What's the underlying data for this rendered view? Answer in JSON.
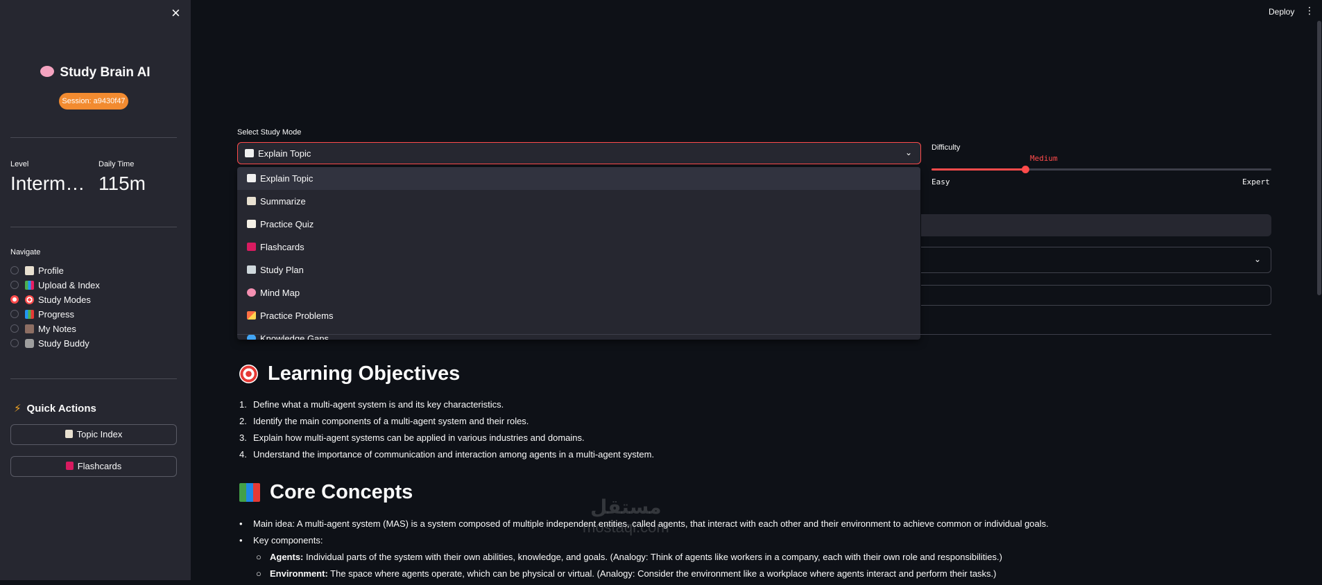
{
  "sidebar": {
    "close_icon": "×",
    "brand_title": "Study Brain AI",
    "session_badge": "Session: a9430f47",
    "metrics": {
      "level_label": "Level",
      "level_value": "Intermediate",
      "daily_time_label": "Daily Time",
      "daily_time_value": "115m"
    },
    "navigate_label": "Navigate",
    "nav_items": [
      {
        "label": "Profile",
        "icon": "memo-icon",
        "selected": false
      },
      {
        "label": "Upload & Index",
        "icon": "books-icon",
        "selected": false
      },
      {
        "label": "Study Modes",
        "icon": "target-icon",
        "selected": true
      },
      {
        "label": "Progress",
        "icon": "bar-chart-icon",
        "selected": false
      },
      {
        "label": "My Notes",
        "icon": "notebook-icon",
        "selected": false
      },
      {
        "label": "Study Buddy",
        "icon": "robot-icon",
        "selected": false
      }
    ],
    "quick_actions_title": "Quick Actions",
    "quick_actions": [
      {
        "label": "Topic Index",
        "icon": "clipboard-icon"
      },
      {
        "label": "Flashcards",
        "icon": "flashcard-icon"
      }
    ]
  },
  "topbar": {
    "deploy_label": "Deploy",
    "menu_icon": "⋮"
  },
  "study_mode": {
    "label": "Select Study Mode",
    "selected": "Explain Topic",
    "options": [
      {
        "label": "Explain Topic",
        "icon": "book-icon"
      },
      {
        "label": "Summarize",
        "icon": "clipboard-icon"
      },
      {
        "label": "Practice Quiz",
        "icon": "memo-icon"
      },
      {
        "label": "Flashcards",
        "icon": "flashcard-icon"
      },
      {
        "label": "Study Plan",
        "icon": "calendar-icon"
      },
      {
        "label": "Mind Map",
        "icon": "brain-icon"
      },
      {
        "label": "Practice Problems",
        "icon": "pencil-icon"
      },
      {
        "label": "Knowledge Gaps",
        "icon": "magnifier-icon"
      }
    ]
  },
  "difficulty": {
    "label": "Difficulty",
    "current": "Medium",
    "min_label": "Easy",
    "max_label": "Expert",
    "position_fraction": 0.275
  },
  "content": {
    "objectives_title": "Learning Objectives",
    "objectives": [
      "Define what a multi-agent system is and its key characteristics.",
      "Identify the main components of a multi-agent system and their roles.",
      "Explain how multi-agent systems can be applied in various industries and domains.",
      "Understand the importance of communication and interaction among agents in a multi-agent system."
    ],
    "core_title": "Core Concepts",
    "core_main": "Main idea: A multi-agent system (MAS) is a system composed of multiple independent entities, called agents, that interact with each other and their environment to achieve common or individual goals.",
    "core_key_components": "Key components:",
    "components": [
      {
        "term": "Agents:",
        "text": " Individual parts of the system with their own abilities, knowledge, and goals. (Analogy: Think of agents like workers in a company, each with their own role and responsibilities.)"
      },
      {
        "term": "Environment:",
        "text": " The space where agents operate, which can be physical or virtual. (Analogy: Consider the environment like a workplace where agents interact and perform their tasks.)"
      }
    ]
  },
  "watermark": {
    "arabic": "مستقل",
    "latin": "mostaql.com"
  },
  "colors": {
    "accent": "#ff4b4b",
    "badge": "#f28b30",
    "sidebar_bg": "#262730",
    "main_bg": "#0e1117"
  }
}
